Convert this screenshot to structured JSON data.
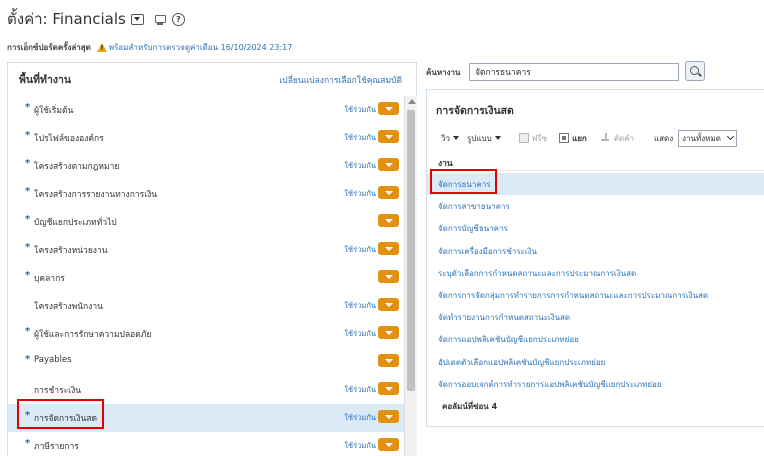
{
  "header": {
    "title": "ตั้งค่า: Financials",
    "dropdown_icon": "chevron-down-icon",
    "monitor_icon": "monitor-icon",
    "help_icon": "help-icon",
    "help_glyph": "?"
  },
  "status": {
    "label": "การเอ็กซ์ปอร์ตครั้งล่าสุด",
    "icon": "warning-icon",
    "text": "พร้อมสำหรับการตรวจดูค่าเดือน 16/10/2024 23:17"
  },
  "left_panel": {
    "title": "พื้นที่ทำงาน",
    "change_link": "เปลี่ยนแปลงการเลือกใช้คุณสมบัติ",
    "items": [
      {
        "label": "ผู้ใช้เริ่มต้น",
        "required": true,
        "in_use": "ใช้ร่วมกัน",
        "selected": false
      },
      {
        "label": "โปรไฟล์ขององค์กร",
        "required": true,
        "in_use": "ใช้ร่วมกัน",
        "selected": false
      },
      {
        "label": "โครงสร้างตามกฎหมาย",
        "required": true,
        "in_use": "ใช้ร่วมกัน",
        "selected": false
      },
      {
        "label": "โครงสร้างการรายงานทางการเงิน",
        "required": true,
        "in_use": "ใช้ร่วมกัน",
        "selected": false
      },
      {
        "label": "บัญชีแยกประเภททั่วไป",
        "required": true,
        "in_use": "",
        "selected": false
      },
      {
        "label": "โครงสร้างหน่วยงาน",
        "required": true,
        "in_use": "ใช้ร่วมกัน",
        "selected": false
      },
      {
        "label": "บุคลากร",
        "required": true,
        "in_use": "",
        "selected": false
      },
      {
        "label": "โครงสร้างพนักงาน",
        "required": false,
        "in_use": "ใช้ร่วมกัน",
        "selected": false
      },
      {
        "label": "ผู้ใช้และการรักษาความปลอดภัย",
        "required": true,
        "in_use": "ใช้ร่วมกัน",
        "selected": false
      },
      {
        "label": "Payables",
        "required": true,
        "in_use": "",
        "selected": false
      },
      {
        "label": "การชำระเงิน",
        "required": false,
        "in_use": "ใช้ร่วมกัน",
        "selected": false
      },
      {
        "label": "การจัดการเงินสด",
        "required": true,
        "in_use": "ใช้ร่วมกัน",
        "selected": true
      },
      {
        "label": "ภาษีรายการ",
        "required": true,
        "in_use": "ใช้ร่วมกัน",
        "selected": false
      }
    ]
  },
  "search": {
    "label": "ค้นหางาน",
    "value": "จัดการธนาคาร",
    "button_icon": "search-icon"
  },
  "right_panel": {
    "title": "การจัดการเงินสด",
    "toolbar": {
      "view": "วิว",
      "format": "รูปแบบ",
      "freeze": "ฟรีซ",
      "detach": "แยก",
      "wrap": "ตัดคำ",
      "show_label": "แสดง",
      "show_value": "งานทั้งหมด"
    },
    "column_header": "งาน",
    "tasks": [
      {
        "label": "จัดการธนาคาร",
        "selected": true
      },
      {
        "label": "จัดการสาขาธนาคาร",
        "selected": false
      },
      {
        "label": "จัดการบัญชีธนาคาร",
        "selected": false
      },
      {
        "label": "จัดการเครื่องมือการชำระเงิน",
        "selected": false
      },
      {
        "label": "ระบุตัวเลือกการกำหนดสถานะและการประมาณการเงินสด",
        "selected": false
      },
      {
        "label": "จัดการการจัดกลุ่มการทำรายการการกำหนดสถานะและการประมาณการเงินสด",
        "selected": false
      },
      {
        "label": "จัดทำรายงานการกำหนดสถานะเงินสด",
        "selected": false
      },
      {
        "label": "จัดการแอปพลิเคชันบัญชีแยกประเภทย่อย",
        "selected": false
      },
      {
        "label": "อัปเดตตัวเลือกแอปพลิเคชันบัญชีแยกประเภทย่อย",
        "selected": false
      },
      {
        "label": "จัดการออบเจกต์การทำรายการแอปพลิเคชันบัญชีแยกประเภทย่อย",
        "selected": false
      }
    ],
    "hidden_columns": "คอลัมน์ที่ซ่อน  4"
  },
  "colors": {
    "link": "#2d72b8",
    "accent_pill": "#e2900f",
    "selected_row": "#dbeaf7",
    "highlight_box": "#e60000"
  }
}
